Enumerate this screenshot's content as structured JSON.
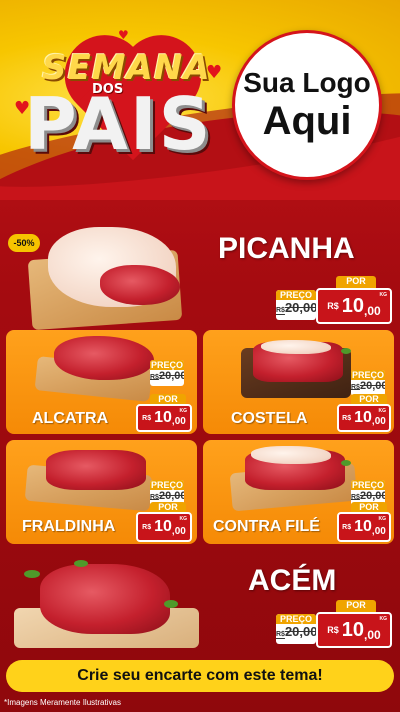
{
  "header": {
    "campaign_line1": "SEMANA",
    "campaign_dos": "DOS",
    "campaign_line2": "PAIS",
    "logo_line1": "Sua Logo",
    "logo_line2": "Aqui"
  },
  "featured": [
    {
      "name": "PICANHA",
      "badge": "-50%",
      "old_label": "PREÇO",
      "old_currency": "R$",
      "old_price": "20,00",
      "new_label": "POR",
      "currency": "R$",
      "price_int": "10",
      "price_cents": ",00",
      "unit": "KG"
    },
    {
      "name": "ACÉM",
      "old_label": "PREÇO",
      "old_currency": "R$",
      "old_price": "20,00",
      "new_label": "POR",
      "currency": "R$",
      "price_int": "10",
      "price_cents": ",00",
      "unit": "KG"
    }
  ],
  "cards": [
    {
      "name": "ALCATRA",
      "old_label": "PREÇO",
      "old_currency": "R$",
      "old_price": "20,00",
      "new_label": "POR",
      "currency": "R$",
      "price_int": "10",
      "price_cents": ",00",
      "unit": "KG"
    },
    {
      "name": "COSTELA",
      "old_label": "PREÇO",
      "old_currency": "R$",
      "old_price": "20,00",
      "new_label": "POR",
      "currency": "R$",
      "price_int": "10",
      "price_cents": ",00",
      "unit": "KG"
    },
    {
      "name": "FRALDINHA",
      "old_label": "PREÇO",
      "old_currency": "R$",
      "old_price": "20,00",
      "new_label": "POR",
      "currency": "R$",
      "price_int": "10",
      "price_cents": ",00",
      "unit": "KG"
    },
    {
      "name": "CONTRA FILÉ",
      "old_label": "PREÇO",
      "old_currency": "R$",
      "old_price": "20,00",
      "new_label": "POR",
      "currency": "R$",
      "price_int": "10",
      "price_cents": ",00",
      "unit": "KG"
    }
  ],
  "cta": "Crie seu encarte com este tema!",
  "disclaimer": "*Imagens Meramente Ilustrativas",
  "colors": {
    "primary_red": "#c8141a",
    "orange": "#f58a06",
    "yellow": "#ffd21a",
    "white": "#ffffff"
  }
}
